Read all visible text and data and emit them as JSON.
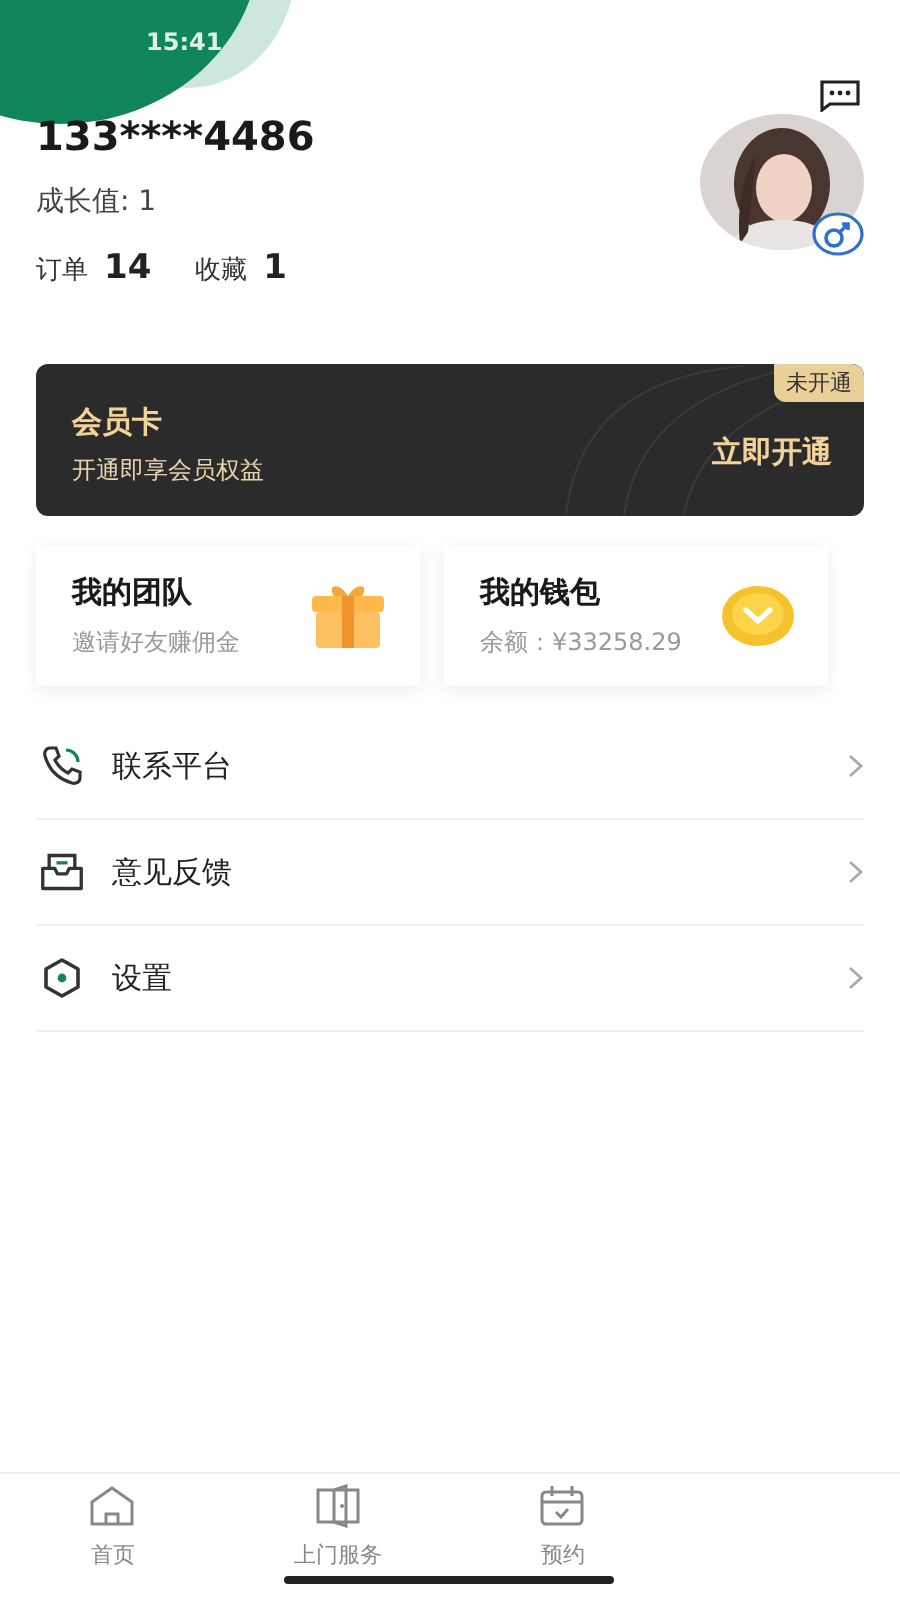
{
  "status_bar": {
    "time": "15:41"
  },
  "profile": {
    "phone": "133****4486",
    "growth": "成长值: 1",
    "stats": [
      {
        "label": "订单",
        "value": "14"
      },
      {
        "label": "收藏",
        "value": "1"
      }
    ]
  },
  "member_card": {
    "title": "会员卡",
    "subtitle": "开通即享会员权益",
    "badge": "未开通",
    "action": "立即开通"
  },
  "tiles": [
    {
      "title": "我的团队",
      "subtitle": "邀请好友赚佣金",
      "kind": "gift"
    },
    {
      "title": "我的钱包",
      "subtitle": "余额：¥33258.29",
      "kind": "coin"
    }
  ],
  "menu": [
    {
      "label": "联系平台",
      "kind": "phone"
    },
    {
      "label": "意见反馈",
      "kind": "inbox"
    },
    {
      "label": "设置",
      "kind": "settings"
    }
  ],
  "tab_bar": [
    {
      "label": "首页",
      "kind": "home",
      "selected": false
    },
    {
      "label": "上门服务",
      "kind": "door",
      "selected": false
    },
    {
      "label": "预约",
      "kind": "calendar",
      "selected": false
    }
  ]
}
